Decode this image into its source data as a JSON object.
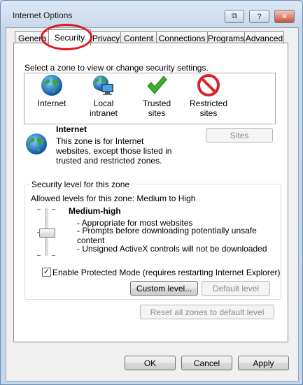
{
  "window": {
    "title": "Internet Options"
  },
  "titlebar_buttons": {
    "restore": "⧉",
    "help": "?",
    "close": "✕"
  },
  "tabs": [
    {
      "label": "General"
    },
    {
      "label": "Security"
    },
    {
      "label": "Privacy"
    },
    {
      "label": "Content"
    },
    {
      "label": "Connections"
    },
    {
      "label": "Programs"
    },
    {
      "label": "Advanced"
    }
  ],
  "security": {
    "instruction": "Select a zone to view or change security settings.",
    "zones": [
      {
        "label": "Internet",
        "icon": "globe-icon"
      },
      {
        "label": "Local intranet",
        "icon": "intranet-icon"
      },
      {
        "label": "Trusted sites",
        "icon": "checkmark-icon"
      },
      {
        "label": "Restricted sites",
        "icon": "restricted-icon"
      }
    ],
    "selected_zone": {
      "name": "Internet",
      "description": "This zone is for Internet websites, except those listed in trusted and restricted zones."
    },
    "sites_button": "Sites",
    "group_title": "Security level for this zone",
    "allowed_levels": "Allowed levels for this zone: Medium to High",
    "level_name": "Medium-high",
    "level_bullets": [
      "- Appropriate for most websites",
      "- Prompts before downloading potentially unsafe",
      "content",
      "- Unsigned ActiveX controls will not be downloaded"
    ],
    "protected_mode_label": "Enable Protected Mode (requires restarting Internet Explorer)",
    "protected_mode_checked": true,
    "custom_level_button": "Custom level...",
    "default_level_button": "Default level",
    "reset_all_button": "Reset all zones to default level"
  },
  "footer": {
    "ok": "OK",
    "cancel": "Cancel",
    "apply": "Apply"
  }
}
